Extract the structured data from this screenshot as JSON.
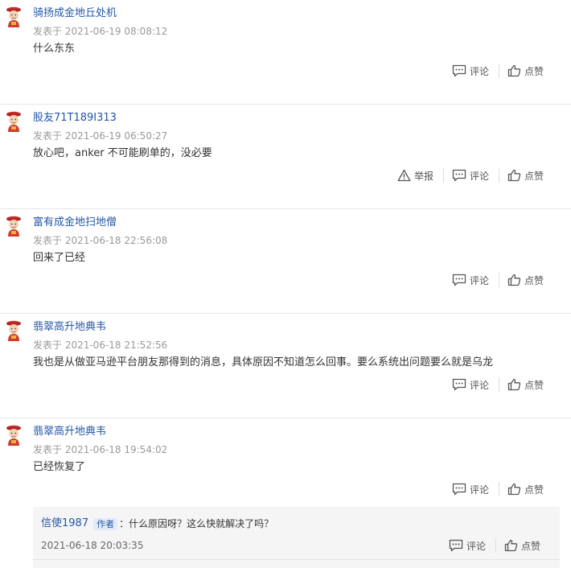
{
  "comments": [
    {
      "username": "骑扬成金地丘处机",
      "meta": "发表于 2021-06-19 08:08:12",
      "content": "什么东东",
      "comment_label": "评论",
      "like_label": "点赞"
    },
    {
      "username": "股友71T189I313",
      "meta": "发表于 2021-06-19 06:50:27",
      "content": "放心吧，anker 不可能刷单的，没必要",
      "report_label": "举报",
      "comment_label": "评论",
      "like_label": "点赞"
    },
    {
      "username": "富有成金地扫地僧",
      "meta": "发表于 2021-06-18 22:56:08",
      "content": "回来了已经",
      "comment_label": "评论",
      "like_label": "点赞"
    },
    {
      "username": "翡翠高升地典韦",
      "meta": "发表于 2021-06-18 21:52:56",
      "content": "我也是从做亚马逊平台朋友那得到的消息，具体原因不知道怎么回事。要么系统出问题要么就是乌龙",
      "comment_label": "评论",
      "like_label": "点赞"
    },
    {
      "username": "翡翠高升地典韦",
      "meta": "发表于 2021-06-18 19:54:02",
      "content": "已经恢复了",
      "comment_label": "评论",
      "like_label": "点赞"
    }
  ],
  "reply": {
    "username": "信使1987",
    "badge": "作者",
    "text": "：什么原因呀？这么快就解决了吗？",
    "date": "2021-06-18 20:03:35",
    "comment_label": "评论",
    "like_label": "点赞"
  },
  "icons": {
    "avatar": "fortune-god-avatar-icon",
    "comment": "comment-bubble-icon",
    "like": "thumbs-up-icon",
    "report": "warning-triangle-icon"
  },
  "colors": {
    "username": "#2356a5",
    "meta": "#999999",
    "divider": "#e6e6e6",
    "reply_bg": "#f5f5f5"
  }
}
